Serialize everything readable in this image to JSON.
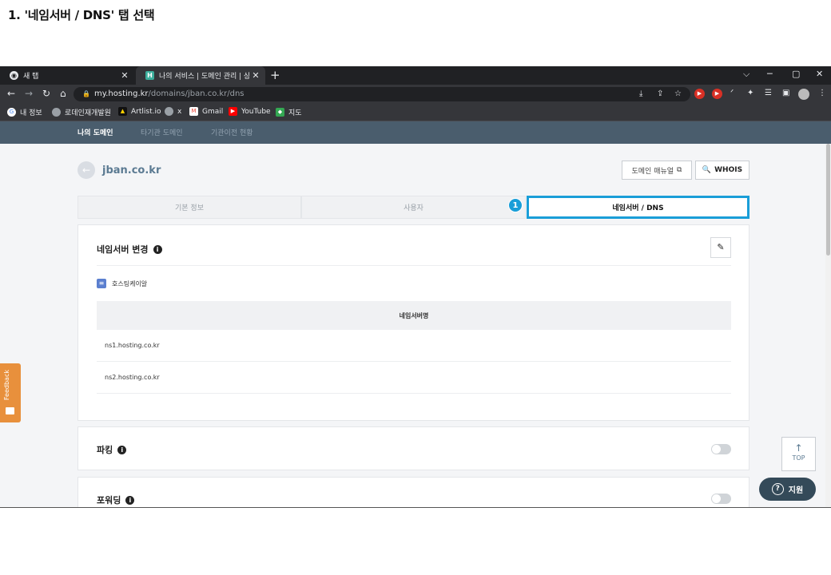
{
  "step_title": "1. '네임서버 / DNS' 탭 선택",
  "browser": {
    "tabs": [
      {
        "label": "새 탭",
        "icon": "chrome-icon"
      },
      {
        "label": "나의 서비스 | 도메인 관리 | 상세",
        "icon": "hosting-favicon",
        "favicon_text": "H"
      }
    ],
    "new_tab": "+",
    "window_controls": [
      "⌵",
      "─",
      "▢",
      "✕"
    ],
    "url_host": "my.hosting.kr",
    "url_path": "/domains/jban.co.kr/dns",
    "bookmarks": [
      {
        "label": "내 정보",
        "icon": "google-icon"
      },
      {
        "label": "로데인재개발원",
        "icon": "globe-icon"
      },
      {
        "label": "Artlist.io",
        "icon": "artlist-icon"
      },
      {
        "label": "x",
        "icon": "globe-icon"
      },
      {
        "label": "Gmail",
        "icon": "gmail-icon"
      },
      {
        "label": "YouTube",
        "icon": "youtube-icon"
      },
      {
        "label": "지도",
        "icon": "maps-icon"
      }
    ]
  },
  "site_nav": {
    "items": [
      {
        "label": "나의 도메인",
        "active": true
      },
      {
        "label": "타기관 도메인",
        "active": false
      },
      {
        "label": "기관이전 현황",
        "active": false
      }
    ]
  },
  "domain": {
    "name": "jban.co.kr",
    "manual_button": "도메인 매뉴얼",
    "whois_button": "WHOIS"
  },
  "tabs": [
    {
      "label": "기본 정보",
      "active": false
    },
    {
      "label": "사용자",
      "active": false
    },
    {
      "label": "네임서버 / DNS",
      "active": true
    }
  ],
  "step_badge": "1",
  "nameserver_card": {
    "title": "네임서버 변경",
    "group_label": "호스팅케이알",
    "column_header": "네임서버명",
    "rows": [
      "ns1.hosting.co.kr",
      "ns2.hosting.co.kr"
    ]
  },
  "parking_card": {
    "title": "파킹",
    "enabled": false
  },
  "forwarding_card": {
    "title": "포워딩",
    "enabled": false
  },
  "feedback_label": "Feedback",
  "top_button": "TOP",
  "support_button": "지원",
  "colors": {
    "accent_blue": "#1a9ed8",
    "nav_bg": "#4a5d6d",
    "feedback_orange": "#e8903c",
    "support_bg": "#344a59"
  }
}
